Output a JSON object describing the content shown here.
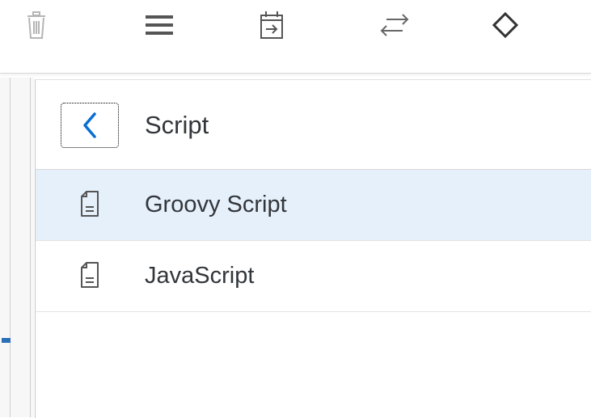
{
  "toolbar": {
    "icons": [
      "delete-icon",
      "menu-icon",
      "calendar-icon",
      "swap-icon",
      "diamond-icon"
    ]
  },
  "popover": {
    "title": "Script",
    "items": [
      {
        "label": "Groovy Script",
        "icon": "document-icon",
        "selected": true
      },
      {
        "label": "JavaScript",
        "icon": "document-icon",
        "selected": false
      }
    ]
  },
  "colors": {
    "selection": "#e6f0fb",
    "accent": "#0a6ed1",
    "text": "#32363a",
    "icon": "#555555"
  }
}
